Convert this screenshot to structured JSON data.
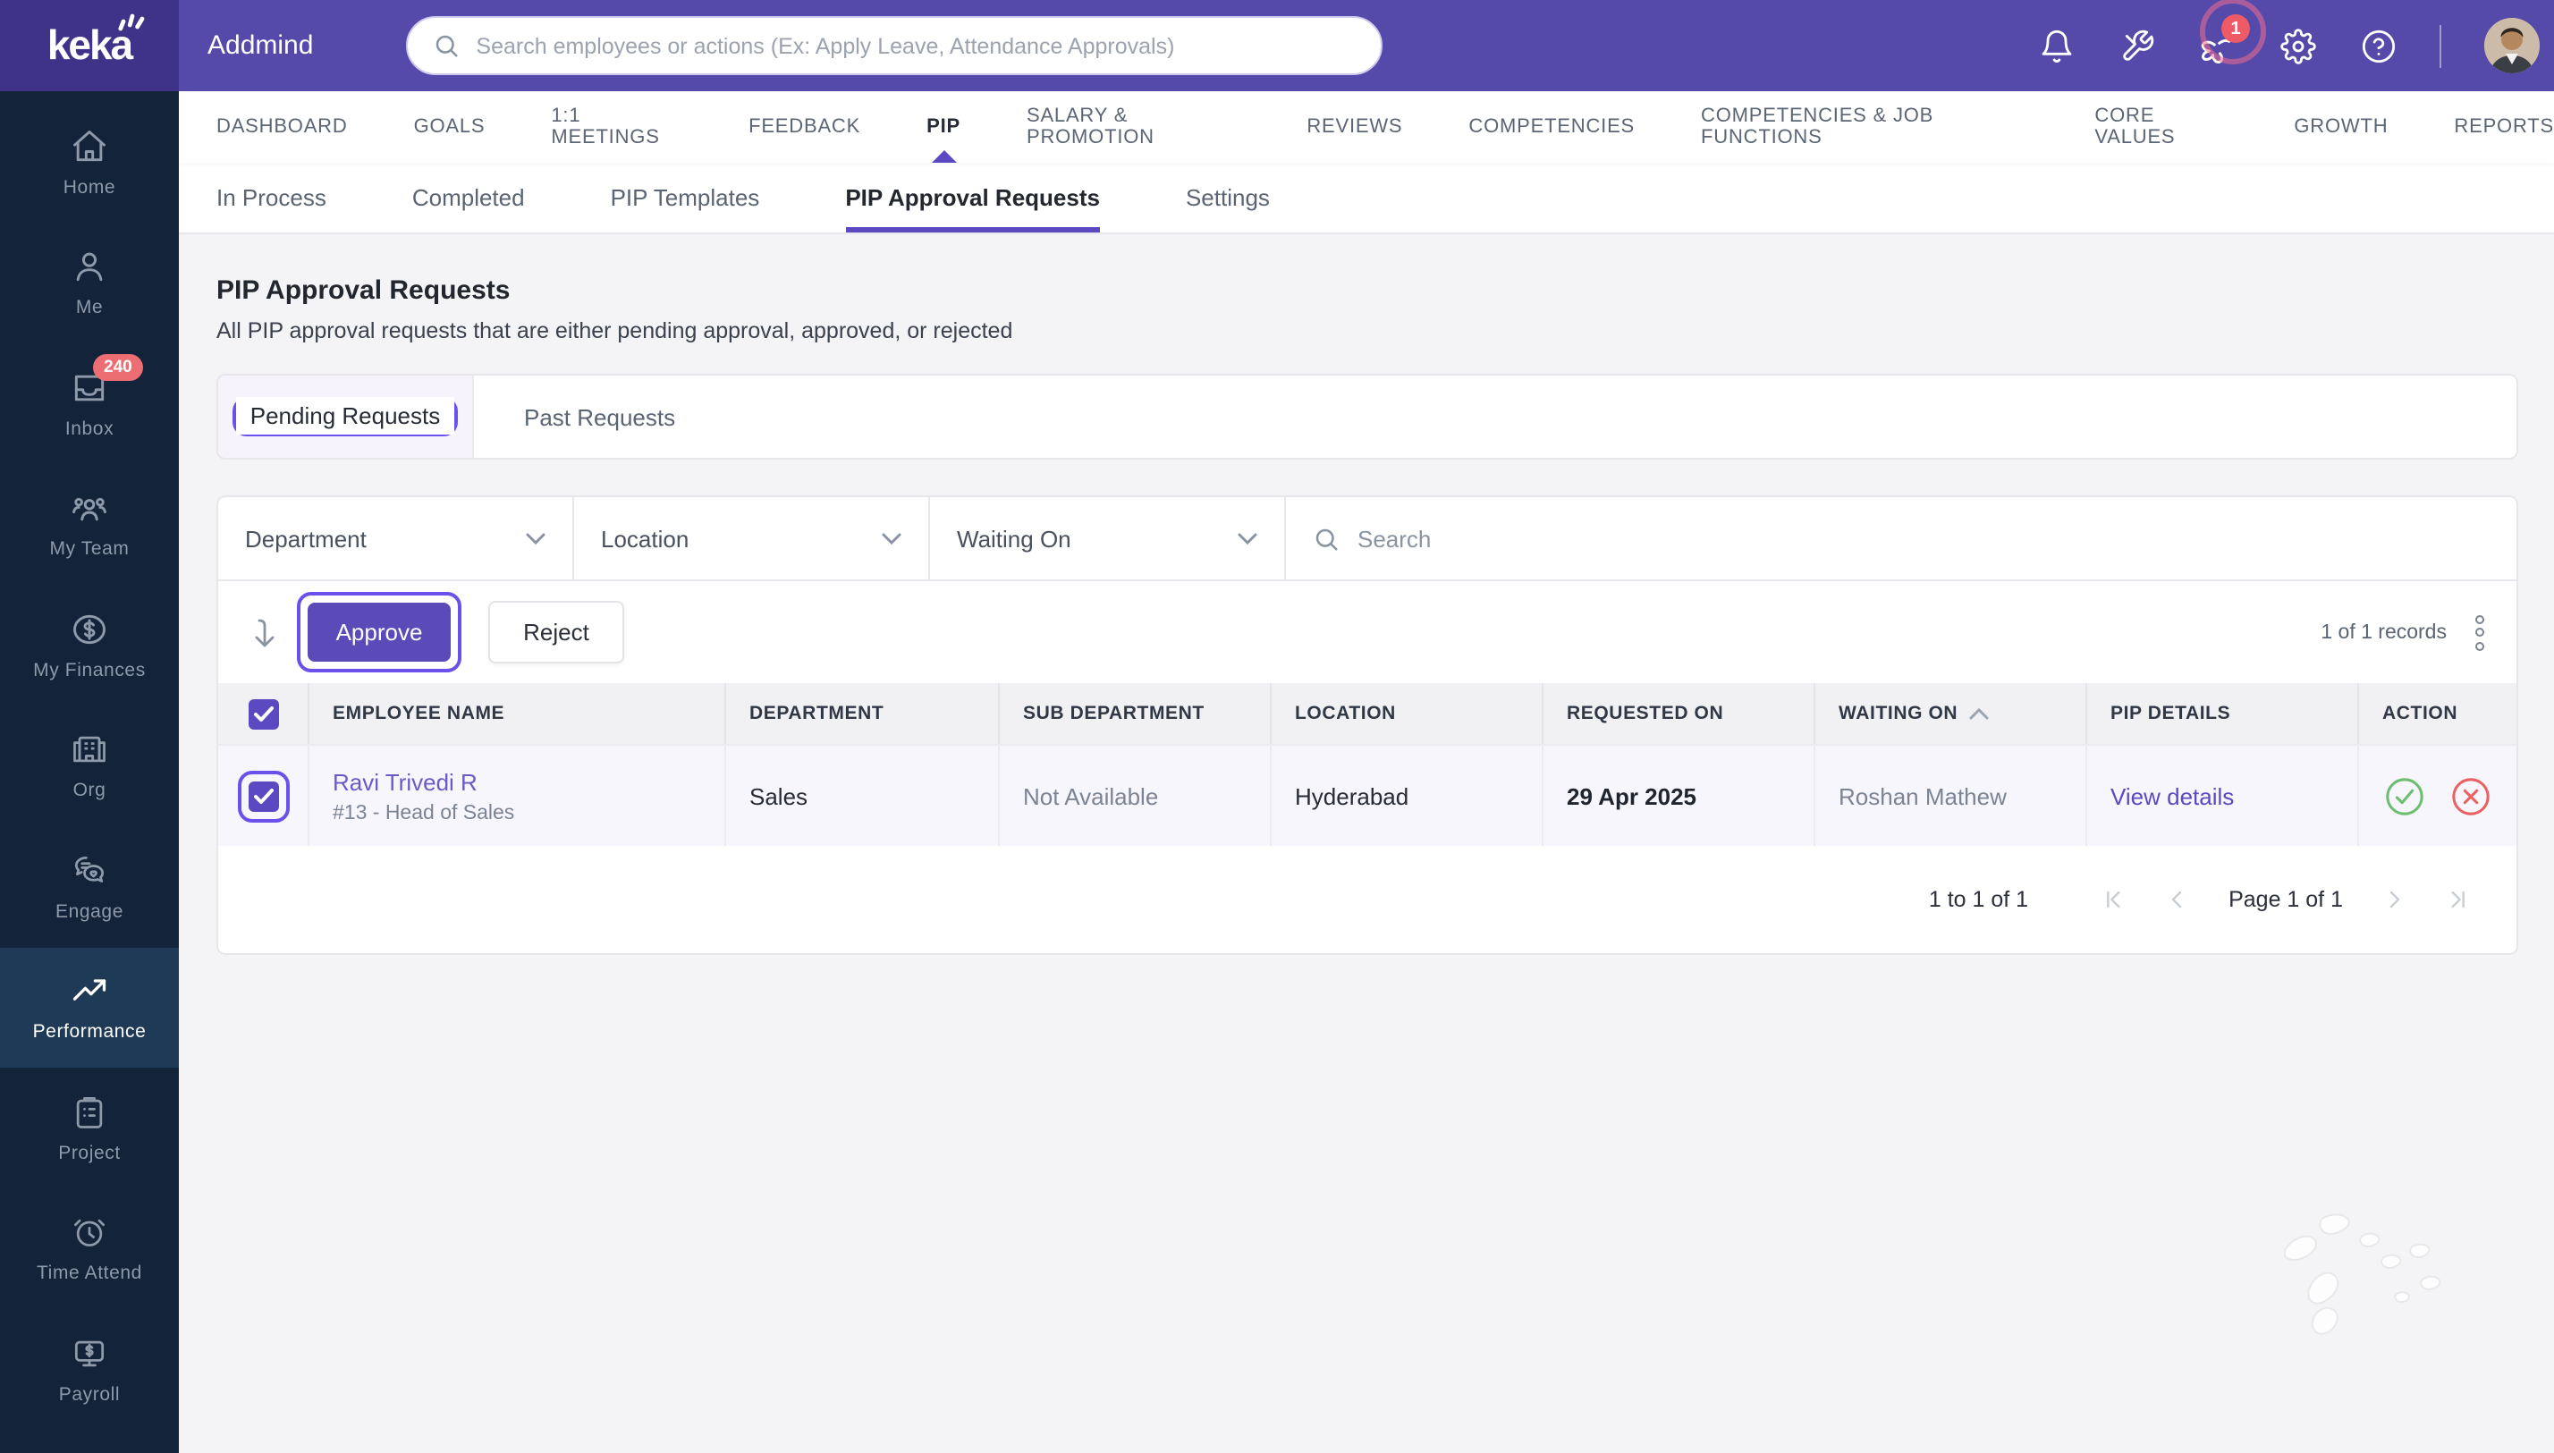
{
  "topbar": {
    "logo": "keka",
    "company": "Addmind",
    "search_placeholder": "Search employees or actions (Ex: Apply Leave, Attendance Approvals)",
    "notification_badge": "1"
  },
  "sidebar": {
    "items": [
      {
        "label": "Home"
      },
      {
        "label": "Me"
      },
      {
        "label": "Inbox",
        "badge": "240"
      },
      {
        "label": "My Team"
      },
      {
        "label": "My Finances"
      },
      {
        "label": "Org"
      },
      {
        "label": "Engage"
      },
      {
        "label": "Performance",
        "active": true
      },
      {
        "label": "Project"
      },
      {
        "label": "Time Attend"
      },
      {
        "label": "Payroll"
      }
    ]
  },
  "main_nav": {
    "active": "PIP",
    "items": [
      "DASHBOARD",
      "GOALS",
      "1:1 MEETINGS",
      "FEEDBACK",
      "PIP",
      "SALARY & PROMOTION",
      "REVIEWS",
      "COMPETENCIES",
      "COMPETENCIES & JOB FUNCTIONS",
      "CORE VALUES",
      "GROWTH",
      "REPORTS"
    ]
  },
  "sub_nav": {
    "active": "PIP Approval Requests",
    "items": [
      "In Process",
      "Completed",
      "PIP Templates",
      "PIP Approval Requests",
      "Settings"
    ]
  },
  "page": {
    "title": "PIP Approval Requests",
    "subtitle": "All PIP approval requests that are either pending approval, approved, or rejected"
  },
  "request_tabs": {
    "pending": "Pending Requests",
    "past": "Past Requests"
  },
  "filters": {
    "department": "Department",
    "location": "Location",
    "waiting_on": "Waiting On",
    "search_placeholder": "Search"
  },
  "toolbar": {
    "approve_label": "Approve",
    "reject_label": "Reject",
    "records": "1 of 1 records"
  },
  "table": {
    "headers": [
      "EMPLOYEE NAME",
      "DEPARTMENT",
      "SUB DEPARTMENT",
      "LOCATION",
      "REQUESTED ON",
      "WAITING ON",
      "PIP DETAILS",
      "ACTION"
    ],
    "row": {
      "employee_name": "Ravi Trivedi R",
      "employee_meta": "#13 - Head of Sales",
      "department": "Sales",
      "sub_department": "Not Available",
      "location": "Hyderabad",
      "requested_on": "29 Apr 2025",
      "waiting_on": "Roshan Mathew",
      "pip_details": "View details"
    }
  },
  "pagination": {
    "range": "1 to 1 of 1",
    "page": "Page 1 of 1"
  },
  "colors": {
    "topbar": "#5549AA",
    "logo_block": "#3F3389",
    "sidebar": "#12233A",
    "accent": "#5B49C1",
    "highlight_outline": "#6C50EC",
    "badge_red": "#ED6E72",
    "link": "#6A5AC6",
    "success": "#6CBE70",
    "danger": "#E96262",
    "row_lavender": "#F8F6FD"
  }
}
